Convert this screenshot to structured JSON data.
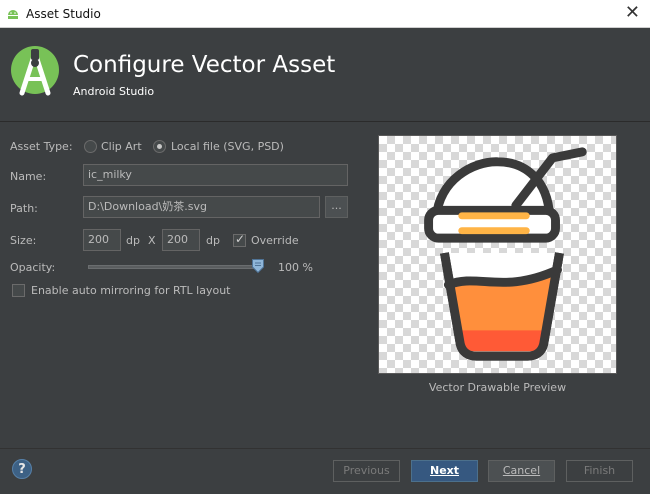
{
  "window": {
    "title": "Asset Studio",
    "close_glyph": "✕"
  },
  "header": {
    "title": "Configure Vector Asset",
    "subtitle": "Android Studio"
  },
  "form": {
    "asset_type_label": "Asset Type:",
    "asset_type_options": [
      {
        "label": "Clip Art",
        "selected": false
      },
      {
        "label": "Local file (SVG, PSD)",
        "selected": true
      }
    ],
    "name_label": "Name:",
    "name_value": "ic_milky",
    "path_label": "Path:",
    "path_value": "D:\\Download\\奶茶.svg",
    "browse_label": "...",
    "size_label": "Size:",
    "width_value": "200",
    "width_unit": "dp",
    "size_separator": "X",
    "height_value": "200",
    "height_unit": "dp",
    "override_label": "Override",
    "override_checked": true,
    "opacity_label": "Opacity:",
    "opacity_value": "100 %",
    "opacity_fraction": 1.0,
    "rtl_label": "Enable auto mirroring for RTL layout",
    "rtl_checked": false
  },
  "preview": {
    "caption": "Vector Drawable Preview"
  },
  "footer": {
    "help_glyph": "?",
    "buttons": {
      "previous": "Previous",
      "next": "Next",
      "cancel": "Cancel",
      "finish": "Finish"
    }
  },
  "colors": {
    "accent": "#365880",
    "android_green": "#78c257",
    "cup_orange": "#ff8f3c",
    "cup_red": "#ff5a36",
    "cup_outline": "#3a3a3a",
    "straw_band": "#ffb446"
  },
  "icons": [
    "android-icon",
    "android-studio-logo",
    "close-icon",
    "radio-icon",
    "checkbox-icon",
    "slider-thumb-icon",
    "help-icon",
    "milk-tea-cup-icon"
  ]
}
